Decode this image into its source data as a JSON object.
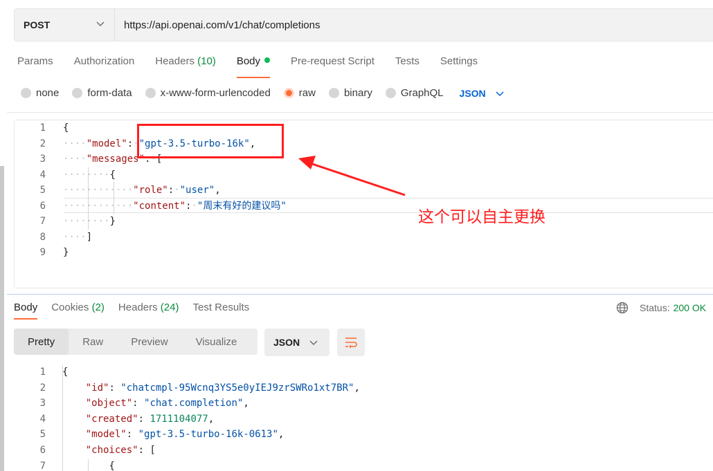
{
  "request": {
    "method": "POST",
    "url": "https://api.openai.com/v1/chat/completions"
  },
  "request_tabs": [
    {
      "label": "Params"
    },
    {
      "label": "Authorization"
    },
    {
      "label": "Headers",
      "count": "(10)"
    },
    {
      "label": "Body"
    },
    {
      "label": "Pre-request Script"
    },
    {
      "label": "Tests"
    },
    {
      "label": "Settings"
    }
  ],
  "body_types": [
    "none",
    "form-data",
    "x-www-form-urlencoded",
    "raw",
    "binary",
    "GraphQL"
  ],
  "body_types_selected": "raw",
  "body_format": "JSON",
  "request_body": {
    "line_numbers": [
      "1",
      "2",
      "3",
      "4",
      "5",
      "6",
      "7",
      "8",
      "9"
    ],
    "lines": [
      "{",
      "\"model\"",
      "\"gpt-3.5-turbo-16k\"",
      "\"messages\"",
      "\"role\"",
      "\"user\"",
      "\"content\"",
      "\"周末有好的建议吗\"",
      "]",
      "}"
    ]
  },
  "annotation": {
    "text": "这个可以自主更换",
    "color": "#ff1e1e"
  },
  "response_tabs": [
    {
      "label": "Body"
    },
    {
      "label": "Cookies",
      "count": "(2)"
    },
    {
      "label": "Headers",
      "count": "(24)"
    },
    {
      "label": "Test Results"
    }
  ],
  "status": {
    "label": "Status:",
    "value": "200 OK"
  },
  "view_modes": [
    "Pretty",
    "Raw",
    "Preview",
    "Visualize"
  ],
  "view_mode_selected": "Pretty",
  "response_format": "JSON",
  "response_body": {
    "line_numbers": [
      "1",
      "2",
      "3",
      "4",
      "5",
      "6",
      "7"
    ],
    "keys": [
      "\"id\"",
      "\"object\"",
      "\"created\"",
      "\"model\"",
      "\"choices\""
    ],
    "values": [
      "\"chatcmpl-95Wcnq3YS5e0yIEJ9zrSWRo1xt7BR\"",
      "\"chat.completion\"",
      "1711104077",
      "\"gpt-3.5-turbo-16k-0613\""
    ]
  },
  "colors": {
    "accent": "#ff6c37",
    "status_green": "#0c8a3c",
    "link_blue": "#0265d2"
  },
  "icons": [
    "chevron-down-icon",
    "globe-icon",
    "wrap-lines-icon"
  ]
}
